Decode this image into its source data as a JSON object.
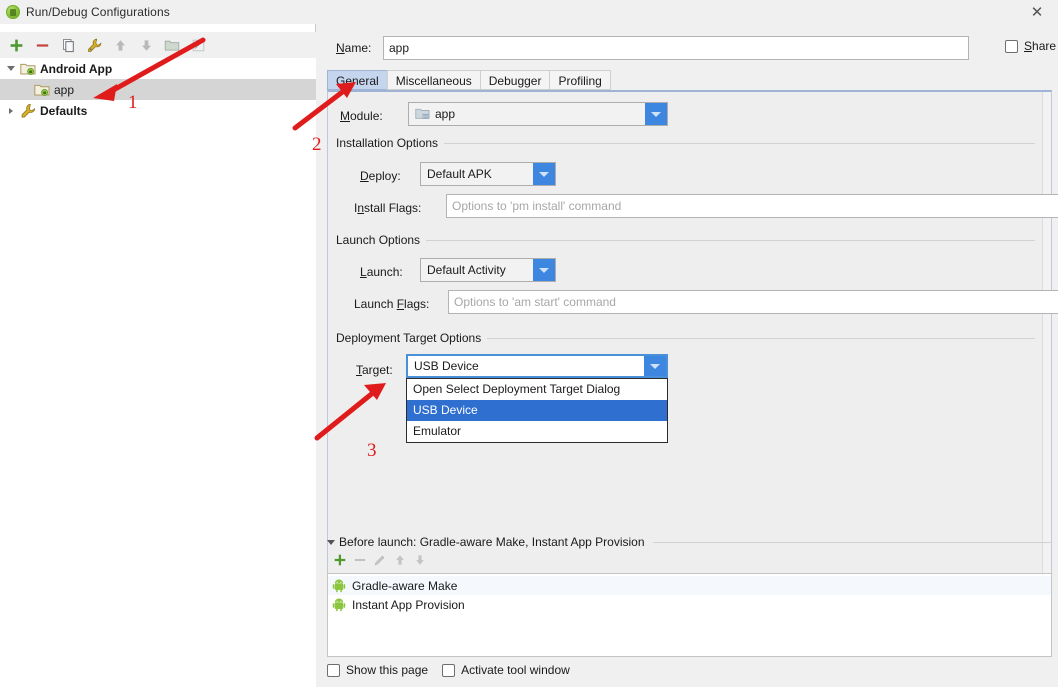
{
  "window": {
    "title": "Run/Debug Configurations",
    "app_icon": "android-studio-icon",
    "close_icon": "close-icon"
  },
  "left_pane": {
    "toolbar": [
      {
        "name": "add-configuration-button",
        "icon": "plus-icon",
        "enabled": true
      },
      {
        "name": "remove-configuration-button",
        "icon": "minus-icon",
        "enabled": true
      },
      {
        "name": "copy-configuration-button",
        "icon": "copy-icon",
        "enabled": true
      },
      {
        "name": "edit-templates-button",
        "icon": "wrench-icon",
        "enabled": true
      },
      {
        "name": "move-up-button",
        "icon": "arrow-up-icon",
        "enabled": false
      },
      {
        "name": "move-down-button",
        "icon": "arrow-down-icon",
        "enabled": false
      },
      {
        "name": "create-folder-button",
        "icon": "folder-icon",
        "enabled": false
      },
      {
        "name": "sort-configurations-button",
        "icon": "sort-icon",
        "enabled": false
      }
    ],
    "tree": [
      {
        "label": "Android App",
        "level": 0,
        "icon": "android-folder-icon",
        "expanded": true,
        "bold": true,
        "selected": false
      },
      {
        "label": "app",
        "level": 1,
        "icon": "android-module-icon",
        "expanded": null,
        "bold": false,
        "selected": true
      },
      {
        "label": "Defaults",
        "level": 0,
        "icon": "wrench-icon",
        "expanded": false,
        "bold": true,
        "selected": false
      }
    ]
  },
  "right_pane": {
    "name_label": "Name:",
    "name_value": "app",
    "share_label": "Share",
    "share_checked": false,
    "tabs": [
      {
        "label": "General",
        "active": true
      },
      {
        "label": "Miscellaneous",
        "active": false
      },
      {
        "label": "Debugger",
        "active": false
      },
      {
        "label": "Profiling",
        "active": false
      }
    ],
    "module": {
      "label": "Module:",
      "value": "app",
      "icon": "module-icon",
      "dropdown_icon": "chevron-down-icon"
    },
    "installation_options": {
      "title": "Installation Options",
      "deploy_label": "Deploy:",
      "deploy_value": "Default APK",
      "install_flags_label": "Install Flags:",
      "install_flags_value": "",
      "install_flags_placeholder": "Options to 'pm install' command"
    },
    "launch_options": {
      "title": "Launch Options",
      "launch_label": "Launch:",
      "launch_value": "Default Activity",
      "launch_flags_label": "Launch Flags:",
      "launch_flags_value": "",
      "launch_flags_placeholder": "Options to 'am start' command"
    },
    "deployment_target_options": {
      "title": "Deployment Target Options",
      "target_label": "Target:",
      "target_value": "USB Device",
      "dropdown_open": true,
      "dropdown_items": [
        {
          "label": "Open Select Deployment Target Dialog",
          "selected": false
        },
        {
          "label": "USB Device",
          "selected": true
        },
        {
          "label": "Emulator",
          "selected": false
        }
      ]
    },
    "before_launch": {
      "title": "Before launch: Gradle-aware Make, Instant App Provision",
      "toolbar": [
        {
          "name": "add-task-button",
          "icon": "plus-icon",
          "enabled": true
        },
        {
          "name": "remove-task-button",
          "icon": "minus-icon",
          "enabled": false
        },
        {
          "name": "edit-task-button",
          "icon": "pencil-icon",
          "enabled": false
        },
        {
          "name": "move-task-up-button",
          "icon": "arrow-up-icon",
          "enabled": false
        },
        {
          "name": "move-task-down-button",
          "icon": "arrow-down-icon",
          "enabled": false
        }
      ],
      "items": [
        {
          "label": "Gradle-aware Make",
          "icon": "android-robot-icon"
        },
        {
          "label": "Instant App Provision",
          "icon": "android-robot-icon"
        }
      ]
    },
    "bottom_options": [
      {
        "label": "Show this page",
        "checked": false,
        "name": "show-this-page-checkbox"
      },
      {
        "label": "Activate tool window",
        "checked": false,
        "name": "activate-tool-window-checkbox"
      }
    ]
  },
  "annotations": [
    {
      "number": "1",
      "color": "#e01b1b"
    },
    {
      "number": "2",
      "color": "#e01b1b"
    },
    {
      "number": "3",
      "color": "#e01b1b"
    }
  ],
  "colors": {
    "accent_blue": "#3d87e0",
    "selection_blue": "#2f6fd0",
    "tab_active": "#c5d5ee",
    "annotation_red": "#e01b1b",
    "android_green": "#7bb236",
    "window_bg": "#f0f0f0",
    "panel_bg": "#eeeeee"
  }
}
